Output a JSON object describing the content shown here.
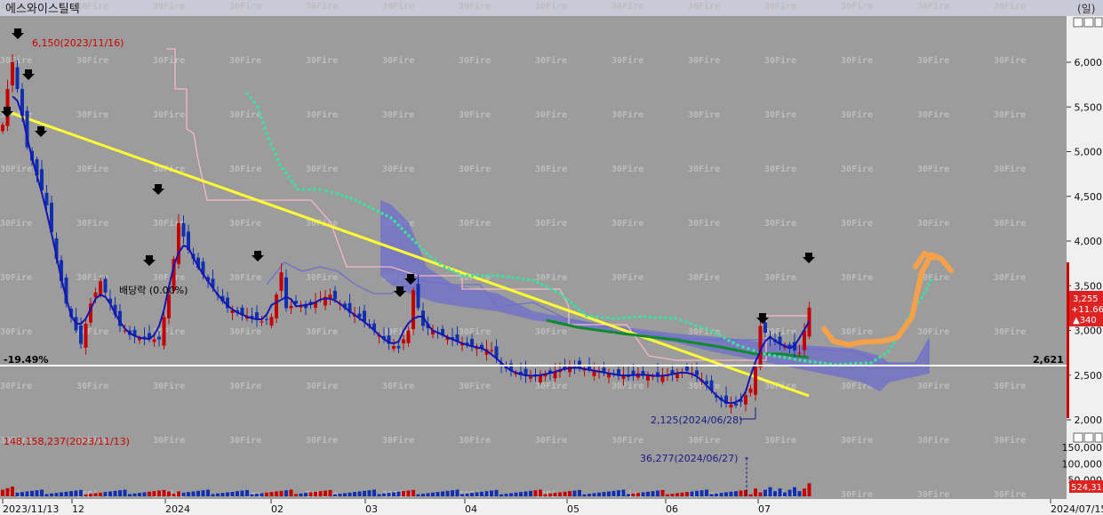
{
  "app": {
    "title": "에스와이스틸텍",
    "corner_label": "(일)",
    "watermark": "30Fire"
  },
  "chart_data": {
    "type": "candlestick",
    "title": "에스와이스틸텍",
    "x_ticks": [
      "2023/11/13",
      "12",
      "2024",
      "02",
      "03",
      "04",
      "05",
      "06",
      "07",
      "2024/07/15"
    ],
    "price_axis": {
      "ticks": [
        2000,
        2500,
        3000,
        3500,
        4000,
        4500,
        5000,
        5500,
        6000
      ],
      "labels": [
        "2,000",
        "2,500",
        "3,000",
        "3,500",
        "4,000",
        "4,500",
        "5,000",
        "5,500",
        "6,000"
      ],
      "ylim": [
        1900,
        6200
      ]
    },
    "volume_axis": {
      "ticks": [
        50000,
        100000,
        150000
      ],
      "labels": [
        "50,000",
        "100,000",
        "150,000"
      ]
    },
    "price_badges": {
      "current": "3,255",
      "change": "+11.66",
      "diff": "▲340"
    },
    "volume_badge": "524,31",
    "reference_line": {
      "value": 2621,
      "label": "2,621",
      "pct_label": "-19.49%"
    },
    "annotations": {
      "high": "6,150(2023/11/16)",
      "low": "2,125(2024/06/28)",
      "volume_high": "148,158,237(2023/11/13)",
      "volume_low": "36,277(2024/06/27)",
      "dividend": "배당락 (0.00%)"
    },
    "close": [
      {
        "i": 0,
        "v": 5300
      },
      {
        "i": 1,
        "v": 5700
      },
      {
        "i": 2,
        "v": 6000
      },
      {
        "i": 3,
        "v": 5700
      },
      {
        "i": 4,
        "v": 5400
      },
      {
        "i": 5,
        "v": 5050
      },
      {
        "i": 6,
        "v": 4900
      },
      {
        "i": 9,
        "v": 4400
      },
      {
        "i": 11,
        "v": 3800
      },
      {
        "i": 13,
        "v": 3300
      },
      {
        "i": 15,
        "v": 3000
      },
      {
        "i": 16,
        "v": 2850
      },
      {
        "i": 18,
        "v": 3300
      },
      {
        "i": 20,
        "v": 3550
      },
      {
        "i": 22,
        "v": 3300
      },
      {
        "i": 24,
        "v": 3050
      },
      {
        "i": 26,
        "v": 2950
      },
      {
        "i": 29,
        "v": 2900
      },
      {
        "i": 32,
        "v": 2900
      },
      {
        "i": 34,
        "v": 3400
      },
      {
        "i": 36,
        "v": 4200
      },
      {
        "i": 38,
        "v": 3900
      },
      {
        "i": 40,
        "v": 3700
      },
      {
        "i": 42,
        "v": 3550
      },
      {
        "i": 44,
        "v": 3400
      },
      {
        "i": 46,
        "v": 3250
      },
      {
        "i": 48,
        "v": 3200
      },
      {
        "i": 50,
        "v": 3150
      },
      {
        "i": 53,
        "v": 3100
      },
      {
        "i": 55,
        "v": 3150
      },
      {
        "i": 57,
        "v": 3650
      },
      {
        "i": 58,
        "v": 3250
      },
      {
        "i": 60,
        "v": 3300
      },
      {
        "i": 62,
        "v": 3250
      },
      {
        "i": 65,
        "v": 3350
      },
      {
        "i": 67,
        "v": 3400
      },
      {
        "i": 69,
        "v": 3300
      },
      {
        "i": 71,
        "v": 3200
      },
      {
        "i": 73,
        "v": 3150
      },
      {
        "i": 75,
        "v": 3050
      },
      {
        "i": 77,
        "v": 2950
      },
      {
        "i": 79,
        "v": 2850
      },
      {
        "i": 81,
        "v": 2800
      },
      {
        "i": 83,
        "v": 3000
      },
      {
        "i": 84,
        "v": 3450
      },
      {
        "i": 86,
        "v": 3050
      },
      {
        "i": 88,
        "v": 3000
      },
      {
        "i": 90,
        "v": 2950
      },
      {
        "i": 92,
        "v": 2900
      },
      {
        "i": 94,
        "v": 2850
      },
      {
        "i": 96,
        "v": 2820
      },
      {
        "i": 98,
        "v": 2800
      },
      {
        "i": 100,
        "v": 2780
      },
      {
        "i": 102,
        "v": 2600
      },
      {
        "i": 104,
        "v": 2550
      },
      {
        "i": 106,
        "v": 2500
      },
      {
        "i": 108,
        "v": 2480
      },
      {
        "i": 110,
        "v": 2500
      },
      {
        "i": 112,
        "v": 2520
      },
      {
        "i": 114,
        "v": 2550
      },
      {
        "i": 116,
        "v": 2600
      },
      {
        "i": 118,
        "v": 2580
      },
      {
        "i": 120,
        "v": 2560
      },
      {
        "i": 122,
        "v": 2540
      },
      {
        "i": 124,
        "v": 2520
      },
      {
        "i": 126,
        "v": 2500
      },
      {
        "i": 128,
        "v": 2480
      },
      {
        "i": 130,
        "v": 2520
      },
      {
        "i": 132,
        "v": 2500
      },
      {
        "i": 134,
        "v": 2480
      },
      {
        "i": 136,
        "v": 2500
      },
      {
        "i": 138,
        "v": 2520
      },
      {
        "i": 140,
        "v": 2550
      },
      {
        "i": 142,
        "v": 2500
      },
      {
        "i": 144,
        "v": 2400
      },
      {
        "i": 146,
        "v": 2250
      },
      {
        "i": 148,
        "v": 2180
      },
      {
        "i": 150,
        "v": 2160
      },
      {
        "i": 151,
        "v": 2200
      },
      {
        "i": 153,
        "v": 2350
      },
      {
        "i": 154,
        "v": 2600
      },
      {
        "i": 155,
        "v": 3050
      },
      {
        "i": 157,
        "v": 2900
      },
      {
        "i": 159,
        "v": 2850
      },
      {
        "i": 161,
        "v": 2800
      },
      {
        "i": 163,
        "v": 2750
      },
      {
        "i": 165,
        "v": 3255
      }
    ],
    "forecast_path": [
      {
        "i": 168,
        "v": 3020
      },
      {
        "i": 170,
        "v": 2880
      },
      {
        "i": 173,
        "v": 2840
      },
      {
        "i": 176,
        "v": 2870
      },
      {
        "i": 180,
        "v": 2880
      },
      {
        "i": 183,
        "v": 2920
      },
      {
        "i": 186,
        "v": 3150
      },
      {
        "i": 188,
        "v": 3650
      },
      {
        "i": 190,
        "v": 3850
      },
      {
        "i": 192,
        "v": 3800
      },
      {
        "i": 194,
        "v": 3670
      }
    ]
  }
}
